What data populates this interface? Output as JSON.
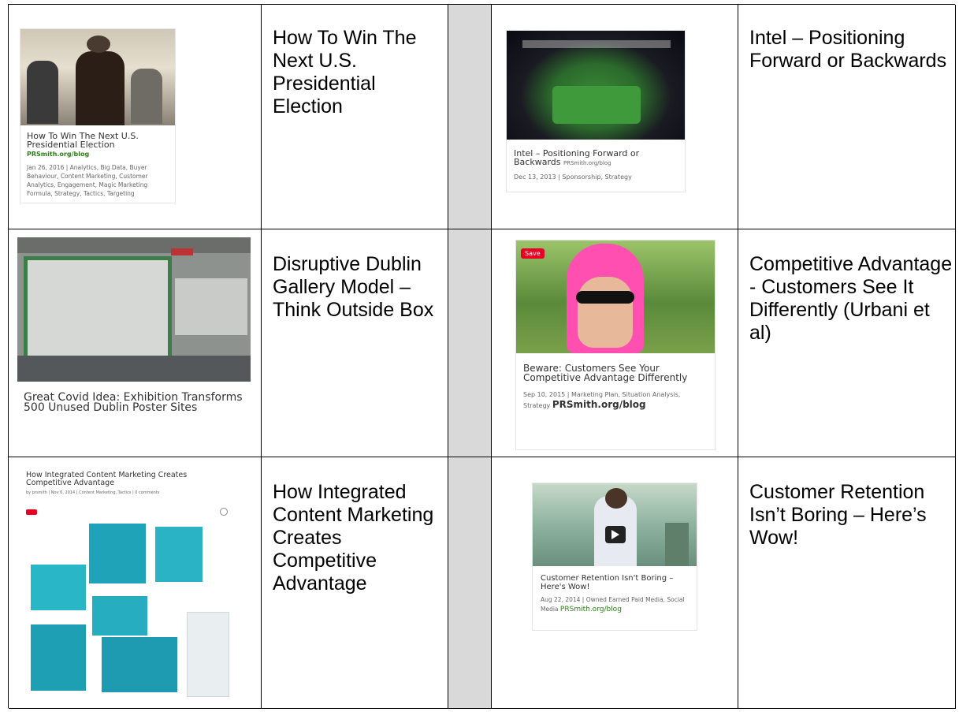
{
  "rows": [
    {
      "left": {
        "card_title": "How To Win The Next U.S. Presidential Election",
        "card_tag": "PRSmith.org/blog",
        "card_meta": "Jan 26, 2016 | Analytics, Big Data, Buyer Behaviour, Content Marketing, Customer Analytics, Engagement, Magic Marketing Formula, Strategy, Tactics, Targeting",
        "label": "How To Win The Next U.S. Presidential Election"
      },
      "right": {
        "card_title": "Intel – Positioning Forward or Backwards",
        "card_tag": "PRSmith.org/blog",
        "card_meta": "Dec 13, 2013 | Sponsorship, Strategy",
        "label": "Intel – Positioning Forward or Backwards"
      }
    },
    {
      "left": {
        "card_title": "Great Covid Idea: Exhibition Transforms 500 Unused Dublin Poster Sites",
        "label": "Disruptive Dublin Gallery Model – Think Outside Box"
      },
      "right": {
        "save_label": "Save",
        "card_title": "Beware: Customers See Your Competitive Advantage Differently",
        "card_meta": "Sep 10, 2015 | Marketing Plan, Situation Analysis, Strategy",
        "card_tag": "PRSmith.org/blog",
        "label": "Competitive Advantage  - Customers See It Differently (Urbani et al)"
      }
    },
    {
      "left": {
        "card_title": "How Integrated Content Marketing Creates Competitive Advantage",
        "card_byline": "by prsmith | Nov 6, 2014 | Content Marketing, Tactics | 0 comments",
        "label": "How Integrated Content Marketing Creates Competitive Advantage"
      },
      "right": {
        "card_title": "Customer Retention Isn't Boring – Here's Wow!",
        "card_meta": "Aug 22, 2014 | Owned Earned Paid Media, Social Media",
        "card_tag": "PRSmith.org/blog",
        "label": "Customer Retention Isn’t Boring – Here’s Wow!"
      }
    }
  ]
}
